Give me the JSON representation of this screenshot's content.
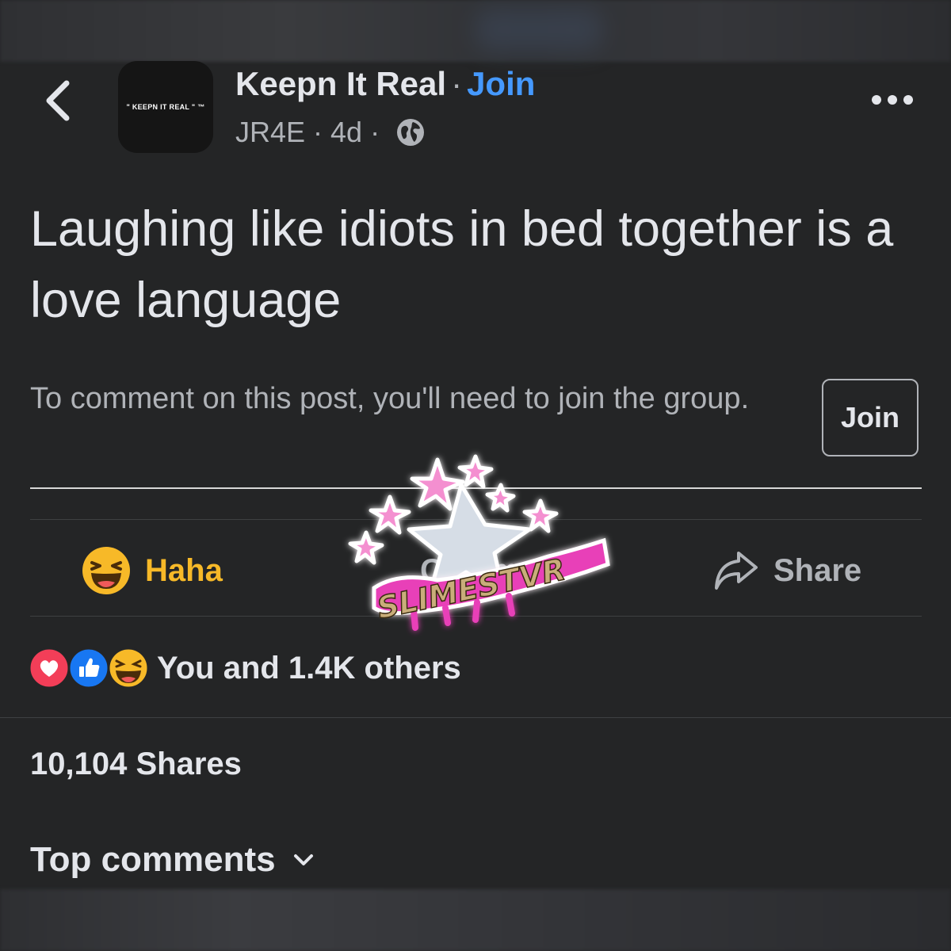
{
  "header": {
    "group_name": "Keepn It Real",
    "dot": "·",
    "join_label": "Join",
    "author": "JR4E",
    "time": "4d",
    "avatar_text": "\" KEEPN IT REAL \" ™",
    "icons": {
      "back": "chevron-left-icon",
      "privacy": "globe-icon",
      "more": "more-horizontal-icon"
    }
  },
  "post": {
    "text": "Laughing like idiots in bed together is a love language"
  },
  "comment_gate": {
    "note": "To comment on this post, you'll need to join the group.",
    "join_button": "Join"
  },
  "actions": {
    "reaction_label": "Haha",
    "comment_label": "Comment",
    "share_label": "Share"
  },
  "reactions": {
    "summary": "You and 1.4K others",
    "types": [
      "love",
      "like",
      "haha"
    ]
  },
  "shares": {
    "label": "10,104 Shares"
  },
  "comments": {
    "top_label": "Top comments"
  },
  "watermark": {
    "text": "SLIMESTVR"
  },
  "colors": {
    "background": "#242526",
    "primary_text": "#e4e6eb",
    "secondary_text": "#b0b3b8",
    "link_blue": "#4599ff",
    "haha_yellow": "#f7b928",
    "love_red": "#f33e58",
    "like_blue": "#1877f2"
  }
}
